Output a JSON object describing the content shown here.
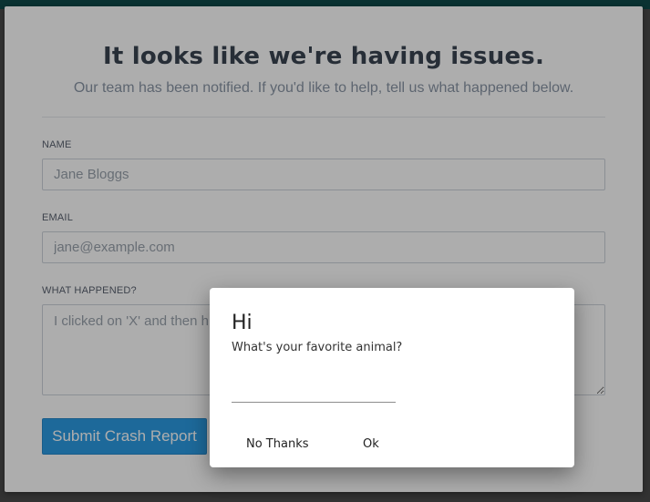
{
  "report": {
    "title": "It looks like we're having issues.",
    "subtitle": "Our team has been notified. If you'd like to help, tell us what happened below.",
    "name_label": "NAME",
    "name_placeholder": "Jane Bloggs",
    "email_label": "EMAIL",
    "email_placeholder": "jane@example.com",
    "what_label": "WHAT HAPPENED?",
    "what_placeholder": "I clicked on 'X' and then hit 'Confirm'",
    "submit_label": "Submit Crash Report"
  },
  "prompt": {
    "title": "Hi",
    "message": "What's your favorite animal?",
    "input_value": "",
    "cancel_label": "No Thanks",
    "ok_label": "Ok"
  }
}
